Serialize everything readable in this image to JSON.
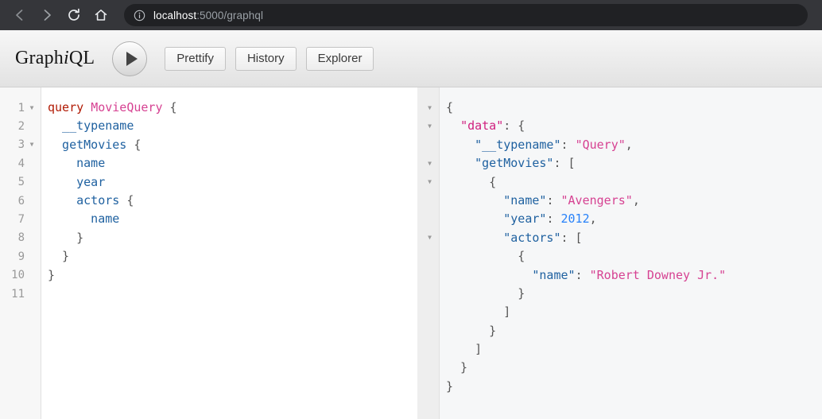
{
  "browser": {
    "back_icon": "arrow-left-icon",
    "forward_icon": "arrow-right-icon",
    "reload_icon": "reload-icon",
    "home_icon": "home-icon",
    "info_icon": "info-circle-icon",
    "url_host": "localhost",
    "url_rest": ":5000/graphql",
    "chrome_bg": "#35363a",
    "omnibox_bg": "#202124"
  },
  "toolbar": {
    "logo_prefix": "Graph",
    "logo_em": "i",
    "logo_suffix": "QL",
    "execute_label": "execute-query",
    "buttons": [
      {
        "label": "Prettify"
      },
      {
        "label": "History"
      },
      {
        "label": "Explorer"
      }
    ]
  },
  "query_editor": {
    "line_numbers": [
      "1",
      "2",
      "3",
      "4",
      "5",
      "6",
      "7",
      "8",
      "9",
      "10",
      "11"
    ],
    "fold_lines": [
      1,
      3
    ],
    "lines": [
      [
        {
          "t": "query",
          "c": "t-keyword"
        },
        {
          "t": " ",
          "c": "t-punct"
        },
        {
          "t": "MovieQuery",
          "c": "t-opname"
        },
        {
          "t": " {",
          "c": "t-punct"
        }
      ],
      [
        {
          "t": "  __typename",
          "c": "t-field"
        }
      ],
      [
        {
          "t": "  getMovies",
          "c": "t-field"
        },
        {
          "t": " {",
          "c": "t-punct"
        }
      ],
      [
        {
          "t": "    name",
          "c": "t-field"
        }
      ],
      [
        {
          "t": "    year",
          "c": "t-field"
        }
      ],
      [
        {
          "t": "    actors",
          "c": "t-field"
        },
        {
          "t": " {",
          "c": "t-punct"
        }
      ],
      [
        {
          "t": "      name",
          "c": "t-field"
        }
      ],
      [
        {
          "t": "    }",
          "c": "t-punct"
        }
      ],
      [
        {
          "t": "  }",
          "c": "t-punct"
        }
      ],
      [
        {
          "t": "}",
          "c": "t-punct"
        }
      ],
      [
        {
          "t": "",
          "c": "t-punct"
        }
      ]
    ],
    "raw_text": "query MovieQuery {\n  __typename\n  getMovies {\n    name\n    year\n    actors {\n      name\n    }\n  }\n}\n"
  },
  "result_viewer": {
    "fold_lines": [
      1,
      2,
      4,
      5,
      8
    ],
    "total_lines": 16,
    "lines": [
      [
        {
          "t": "{",
          "c": "t-brace"
        }
      ],
      [
        {
          "t": "  ",
          "c": "t-brace"
        },
        {
          "t": "\"data\"",
          "c": "t-jsondata"
        },
        {
          "t": ": {",
          "c": "t-brace"
        }
      ],
      [
        {
          "t": "    ",
          "c": "t-brace"
        },
        {
          "t": "\"__typename\"",
          "c": "t-jsonkey"
        },
        {
          "t": ": ",
          "c": "t-brace"
        },
        {
          "t": "\"Query\"",
          "c": "t-string"
        },
        {
          "t": ",",
          "c": "t-brace"
        }
      ],
      [
        {
          "t": "    ",
          "c": "t-brace"
        },
        {
          "t": "\"getMovies\"",
          "c": "t-jsonkey"
        },
        {
          "t": ": [",
          "c": "t-brace"
        }
      ],
      [
        {
          "t": "      {",
          "c": "t-brace"
        }
      ],
      [
        {
          "t": "        ",
          "c": "t-brace"
        },
        {
          "t": "\"name\"",
          "c": "t-jsonkey"
        },
        {
          "t": ": ",
          "c": "t-brace"
        },
        {
          "t": "\"Avengers\"",
          "c": "t-string"
        },
        {
          "t": ",",
          "c": "t-brace"
        }
      ],
      [
        {
          "t": "        ",
          "c": "t-brace"
        },
        {
          "t": "\"year\"",
          "c": "t-jsonkey"
        },
        {
          "t": ": ",
          "c": "t-brace"
        },
        {
          "t": "2012",
          "c": "t-number"
        },
        {
          "t": ",",
          "c": "t-brace"
        }
      ],
      [
        {
          "t": "        ",
          "c": "t-brace"
        },
        {
          "t": "\"actors\"",
          "c": "t-jsonkey"
        },
        {
          "t": ": [",
          "c": "t-brace"
        }
      ],
      [
        {
          "t": "          {",
          "c": "t-brace"
        }
      ],
      [
        {
          "t": "            ",
          "c": "t-brace"
        },
        {
          "t": "\"name\"",
          "c": "t-jsonkey"
        },
        {
          "t": ": ",
          "c": "t-brace"
        },
        {
          "t": "\"Robert Downey Jr.\"",
          "c": "t-string"
        }
      ],
      [
        {
          "t": "          }",
          "c": "t-brace"
        }
      ],
      [
        {
          "t": "        ]",
          "c": "t-brace"
        }
      ],
      [
        {
          "t": "      }",
          "c": "t-brace"
        }
      ],
      [
        {
          "t": "    ]",
          "c": "t-brace"
        }
      ],
      [
        {
          "t": "  }",
          "c": "t-brace"
        }
      ],
      [
        {
          "t": "}",
          "c": "t-brace"
        }
      ]
    ],
    "data": {
      "__typename": "Query",
      "getMovies": [
        {
          "name": "Avengers",
          "year": 2012,
          "actors": [
            {
              "name": "Robert Downey Jr."
            }
          ]
        }
      ]
    }
  },
  "colors": {
    "keyword": "#b11a04",
    "operation_name": "#d64292",
    "field": "#1f61a0",
    "json_key": "#1f61a0",
    "json_data_key": "#d0217f",
    "string": "#d64292",
    "number": "#2882f9",
    "punctuation": "#555555",
    "result_bg": "#f6f7f8",
    "query_bg": "#ffffff"
  }
}
